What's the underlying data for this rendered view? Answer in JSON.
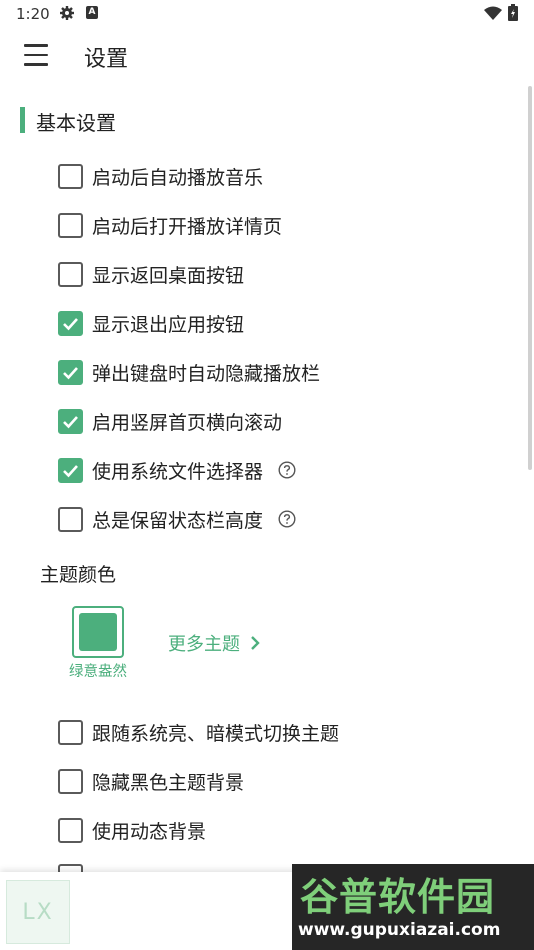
{
  "status_bar": {
    "time": "1:20",
    "a_badge": "A",
    "icons": [
      "gear-icon",
      "a-badge-icon",
      "wifi-icon",
      "battery-icon"
    ]
  },
  "app_bar": {
    "title": "设置",
    "menu_icon": "hamburger-menu-icon"
  },
  "basic_section": {
    "title": "基本设置",
    "items": [
      {
        "label": "启动后自动播放音乐",
        "checked": false,
        "help": false
      },
      {
        "label": "启动后打开播放详情页",
        "checked": false,
        "help": false
      },
      {
        "label": "显示返回桌面按钮",
        "checked": false,
        "help": false
      },
      {
        "label": "显示退出应用按钮",
        "checked": true,
        "help": false
      },
      {
        "label": "弹出键盘时自动隐藏播放栏",
        "checked": true,
        "help": false
      },
      {
        "label": "启用竖屏首页横向滚动",
        "checked": true,
        "help": false
      },
      {
        "label": "使用系统文件选择器",
        "checked": true,
        "help": true
      },
      {
        "label": "总是保留状态栏高度",
        "checked": false,
        "help": true
      }
    ]
  },
  "theme": {
    "heading": "主题颜色",
    "current_name": "绿意盎然",
    "current_color": "#4caf7d",
    "more_label": "更多主题",
    "more_icon": "chevron-right-icon"
  },
  "theme_options": [
    {
      "label": "跟随系统亮、暗模式切换主题",
      "checked": false
    },
    {
      "label": "隐藏黑色主题背景",
      "checked": false
    },
    {
      "label": "使用动态背景",
      "checked": false
    }
  ],
  "player": {
    "art_text": "LX"
  },
  "watermark": {
    "title": "谷普软件园",
    "url": "www.gupuxiazai.com"
  },
  "colors": {
    "accent": "#4caf7d",
    "text": "#222222",
    "checkbox_border": "#5a5a5a"
  }
}
